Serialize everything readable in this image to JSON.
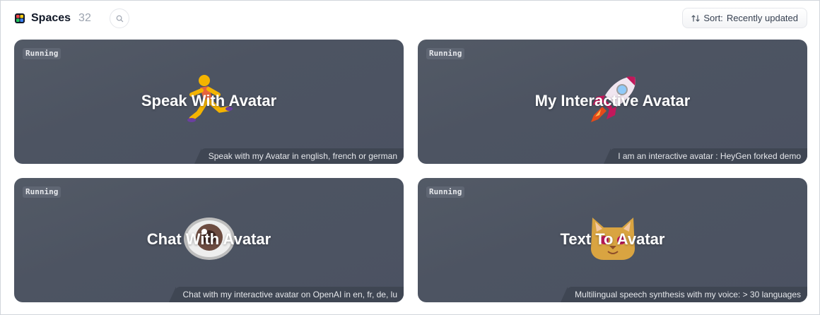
{
  "header": {
    "title": "Spaces",
    "count": "32",
    "search_icon": "search-icon",
    "sort_key": "Sort:",
    "sort_value": "Recently updated"
  },
  "cards": [
    {
      "status": "Running",
      "title": "Speak With Avatar",
      "description": "Speak with my Avatar in english, french or german",
      "emoji": "runner"
    },
    {
      "status": "Running",
      "title": "My Interactive Avatar",
      "description": "I am an interactive avatar : HeyGen forked demo",
      "emoji": "rocket"
    },
    {
      "status": "Running",
      "title": "Chat With Avatar",
      "description": "Chat with my interactive avatar on OpenAI in en, fr, de, lu",
      "emoji": "eye"
    },
    {
      "status": "Running",
      "title": "Text To Avatar",
      "description": "Multilingual speech synthesis with my voice: > 30 languages",
      "emoji": "cat-face"
    }
  ],
  "colors": {
    "card_bg": "#4d5462",
    "desc_bg": "#3f4653",
    "status_bg": "#5f6673"
  }
}
